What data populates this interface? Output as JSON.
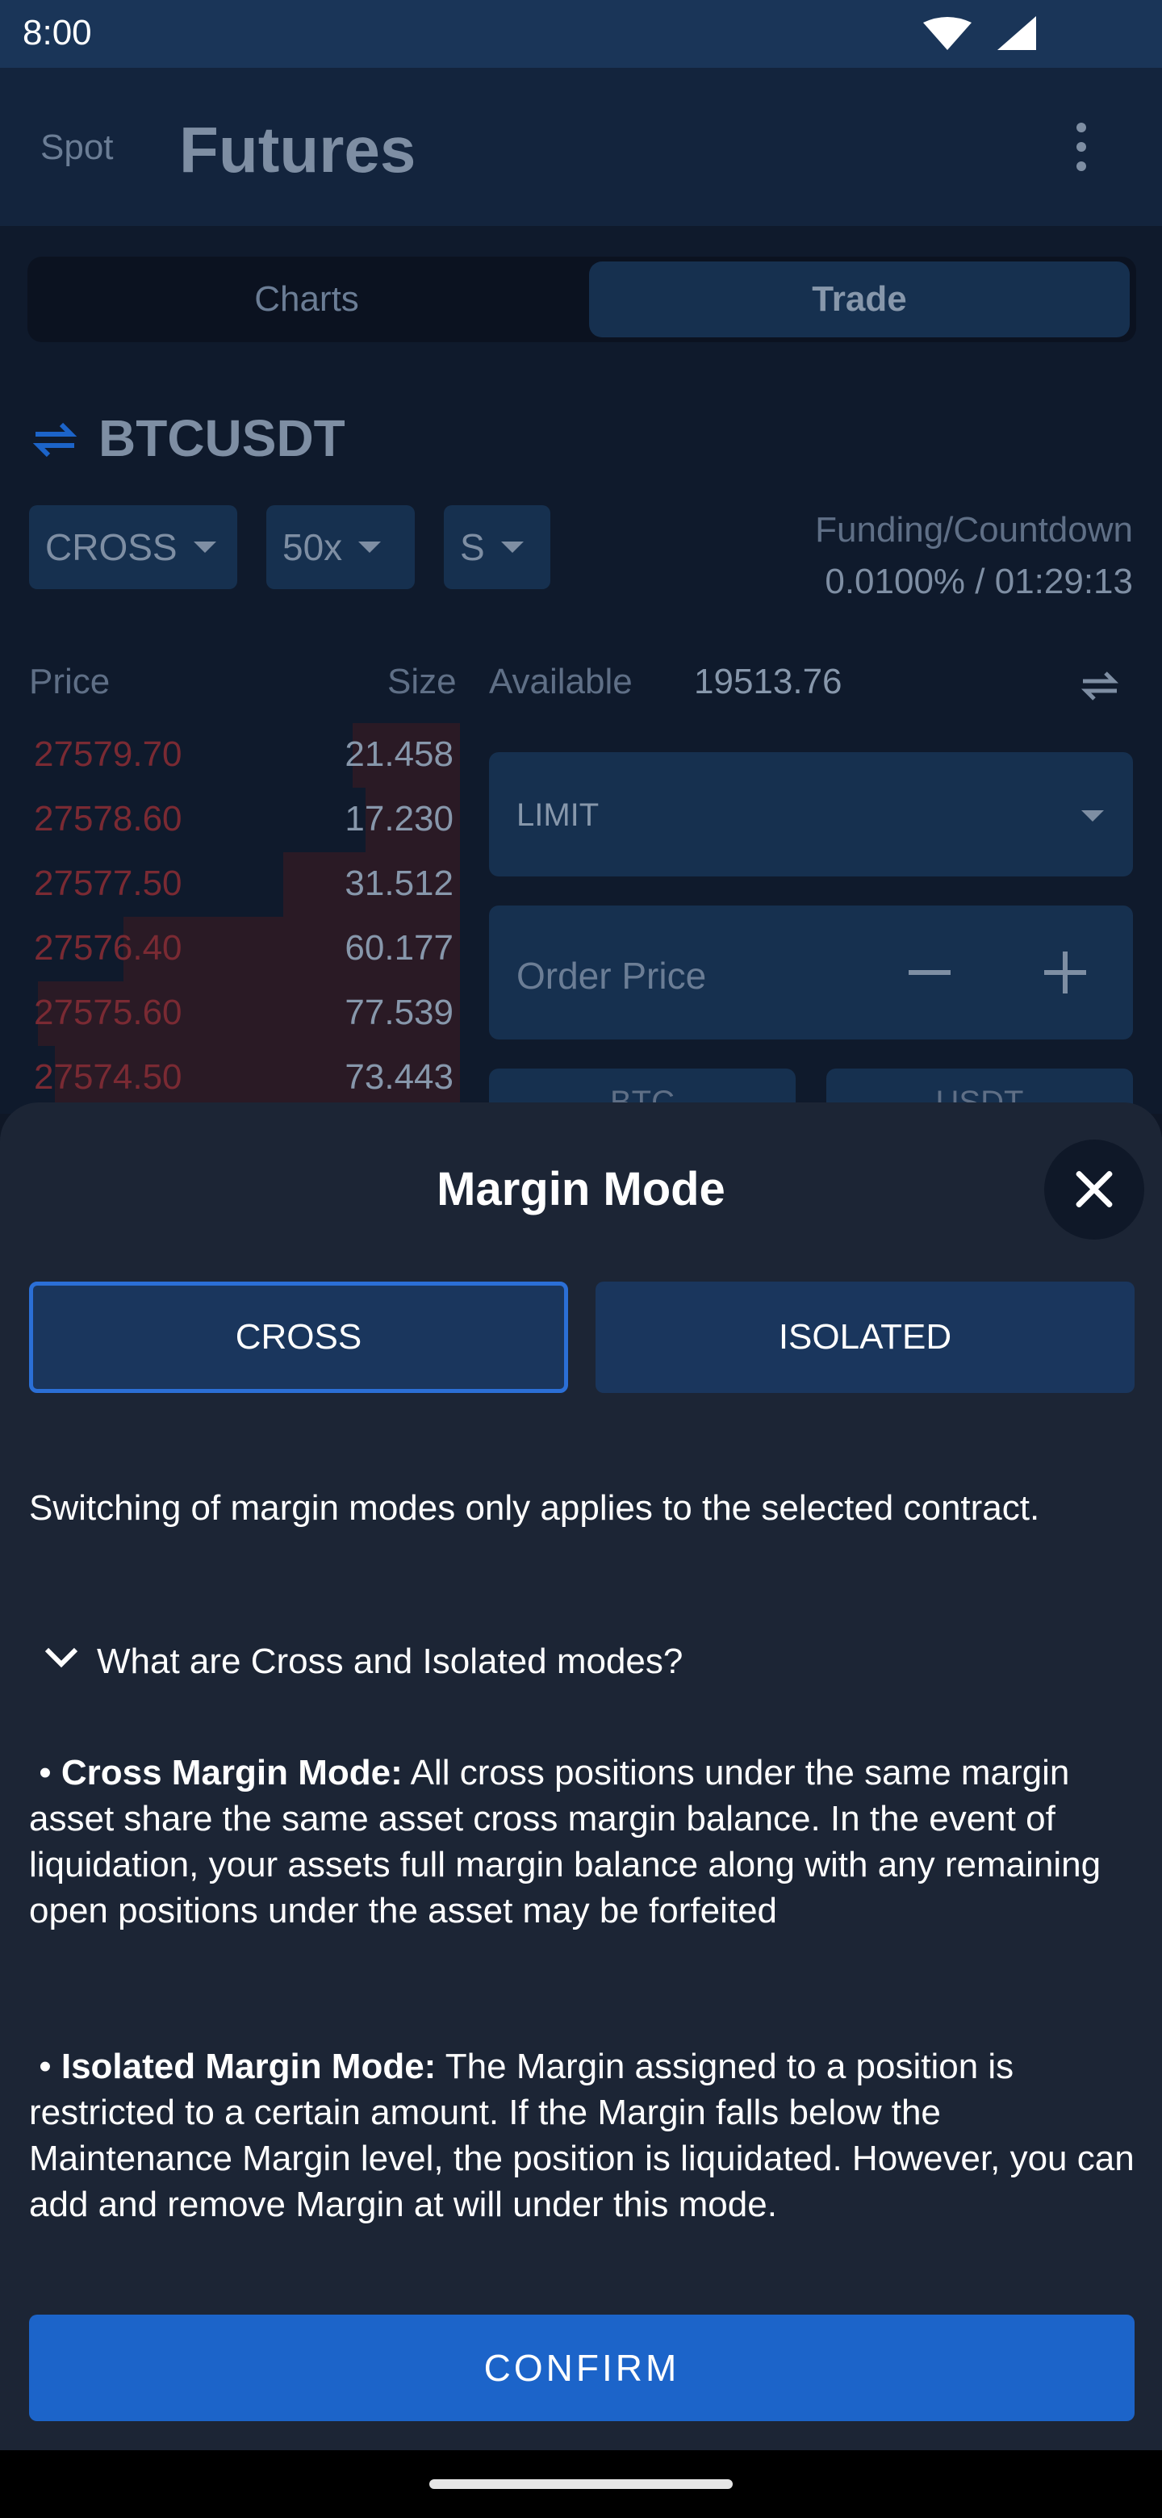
{
  "status_bar": {
    "time": "8:00",
    "wifi_icon": "wifi-icon",
    "signal_icon": "signal-icon"
  },
  "app_bar": {
    "tab_spot": "Spot",
    "tab_futures": "Futures",
    "menu_icon": "more-vert-icon"
  },
  "view_tabs": {
    "charts": "Charts",
    "trade": "Trade"
  },
  "symbol": "BTCUSDT",
  "controls": {
    "margin_mode": "CROSS",
    "leverage": "50x",
    "size_type": "S"
  },
  "funding": {
    "label": "Funding/Countdown",
    "value": "0.0100% / 01:29:13"
  },
  "order_book": {
    "price_header": "Price",
    "size_header": "Size",
    "rows": [
      {
        "price": "27579.70",
        "size": "21.458",
        "depth": 0.25
      },
      {
        "price": "27578.60",
        "size": "17.230",
        "depth": 0.22
      },
      {
        "price": "27577.50",
        "size": "31.512",
        "depth": 0.41
      },
      {
        "price": "27576.40",
        "size": "60.177",
        "depth": 0.78
      },
      {
        "price": "27575.60",
        "size": "77.539",
        "depth": 0.98
      },
      {
        "price": "27574.50",
        "size": "73.443",
        "depth": 0.94
      }
    ]
  },
  "available": {
    "label": "Available",
    "value": "19513.76"
  },
  "order_form": {
    "order_type": "LIMIT",
    "price_placeholder": "Order Price",
    "unit_btc": "BTC",
    "unit_usdt": "USDT"
  },
  "sheet": {
    "title": "Margin Mode",
    "options": {
      "cross": "CROSS",
      "isolated": "ISOLATED"
    },
    "note": "Switching of margin modes only applies to the selected contract.",
    "question": "What are Cross and Isolated modes?",
    "cross_title": "Cross Margin Mode:",
    "cross_body": "All cross positions under the same margin asset share the same asset cross margin balance. In the event of liquidation, your assets full margin balance along with any remaining open positions under the asset may be forfeited",
    "isolated_title": "Isolated Margin Mode:",
    "isolated_body": "The Margin assigned to a position is restricted to a certain amount. If the Margin falls below the Maintenance Margin level, the position is liquidated. However, you can add and remove Margin at will under this mode.",
    "confirm": "CONFIRM"
  },
  "colors": {
    "accent": "#1c64c9",
    "ask": "#c0303c",
    "sheet_bg": "#1c2535"
  }
}
